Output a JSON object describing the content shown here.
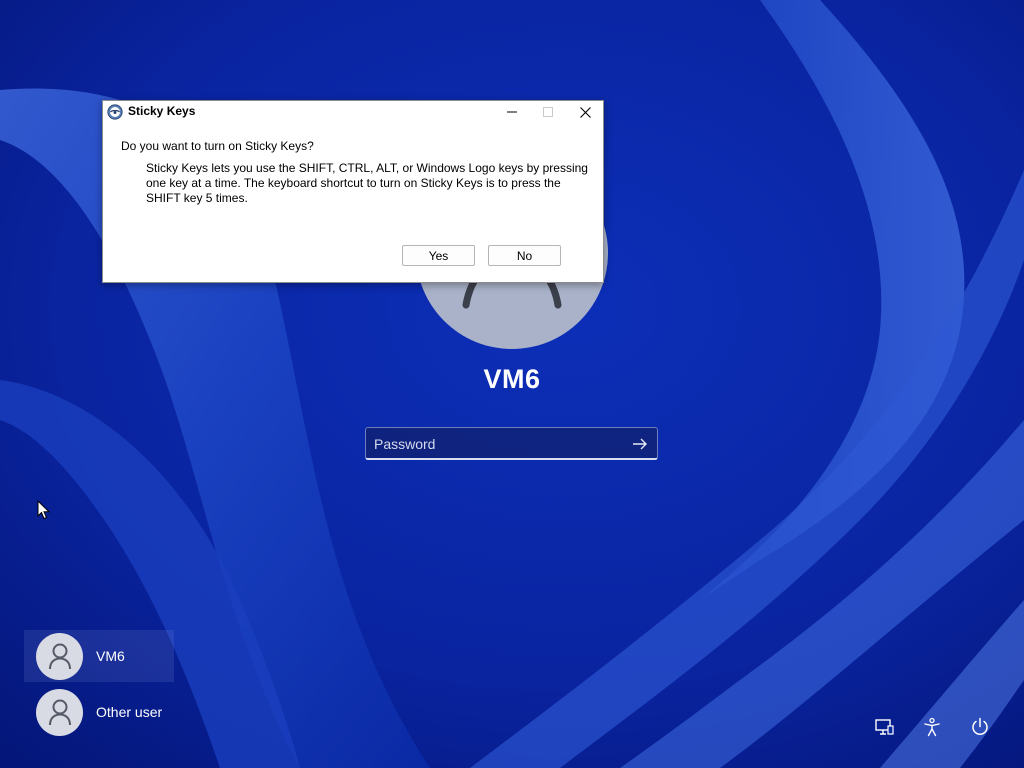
{
  "lockscreen": {
    "user_name": "VM6",
    "password_placeholder": "Password",
    "submit_icon": "arrow-right-icon"
  },
  "dialog": {
    "title": "Sticky Keys",
    "question": "Do you want to turn on Sticky Keys?",
    "explanation": "Sticky Keys lets you use the SHIFT, CTRL, ALT, or Windows Logo keys by pressing one key at a time. The keyboard shortcut to turn on Sticky Keys is to press the SHIFT key 5 times.",
    "yes_label": "Yes",
    "no_label": "No"
  },
  "users": [
    {
      "label": "VM6",
      "selected": true
    },
    {
      "label": "Other user",
      "selected": false
    }
  ],
  "system_icons": [
    "network-icon",
    "accessibility-icon",
    "power-icon"
  ],
  "colors": {
    "wallpaper_deep": "#061a7a",
    "wallpaper_light": "#4f78e6",
    "avatar_bg": "#a9b2c9"
  }
}
